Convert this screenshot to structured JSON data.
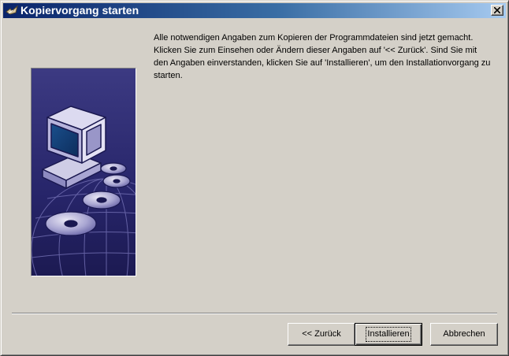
{
  "window": {
    "title": "Kopiervorgang starten",
    "close_symbol": "✕"
  },
  "content": {
    "message": "Alle notwendigen Angaben zum Kopieren der Programmdateien sind jetzt gemacht. Klicken Sie zum Einsehen oder Ändern dieser Angaben auf '<< Zurück'. Sind Sie mit den Angaben einverstanden, klicken Sie auf 'Installieren', um den Installationvorgang zu starten.",
    "illustration": "computer-with-discs-illustration"
  },
  "buttons": {
    "back_label": "<< Zurück",
    "install_label": "Installieren",
    "cancel_label": "Abbrechen"
  },
  "colors": {
    "titlebar_start": "#0a246a",
    "titlebar_end": "#a6caf0",
    "window_bg": "#d4d0c8",
    "illustration_bg": "#2d2b6b"
  }
}
